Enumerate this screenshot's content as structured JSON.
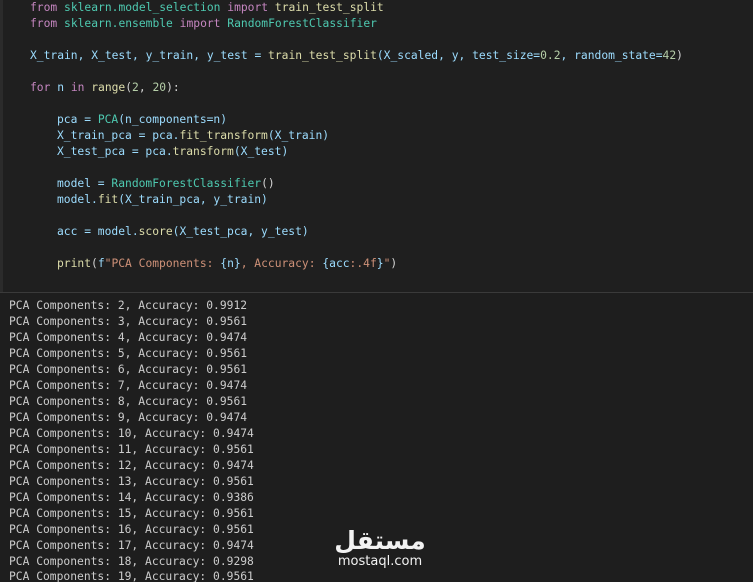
{
  "code": {
    "import1": {
      "kw1": "from",
      "mod": "sklearn.model_selection",
      "kw2": "import",
      "name": "train_test_split"
    },
    "import2": {
      "kw1": "from",
      "mod": "sklearn.ensemble",
      "kw2": "import",
      "name": "RandomForestClassifier"
    },
    "split": {
      "lhs": "X_train, X_test, y_train, y_test = ",
      "fn": "train_test_split",
      "args1": "(X_scaled, y, test_size=",
      "num1": "0.2",
      "args2": ", random_state=",
      "num2": "42",
      "close": ")"
    },
    "loop": {
      "kw1": "for",
      "var": " n ",
      "kw2": "in",
      "fn": " range",
      "open": "(",
      "num1": "2",
      "sep": ", ",
      "num2": "20",
      "close": "):"
    },
    "pca": {
      "lhs": "pca = ",
      "cls": "PCA",
      "args": "(n_components=n)"
    },
    "xtrain_pca": {
      "lhs": "X_train_pca = pca.",
      "fn": "fit_transform",
      "args": "(X_train)"
    },
    "xtest_pca": {
      "lhs": "X_test_pca = pca.",
      "fn": "transform",
      "args": "(X_test)"
    },
    "model": {
      "lhs": "model = ",
      "cls": "RandomForestClassifier",
      "args": "()"
    },
    "fit": {
      "lhs": "model.",
      "fn": "fit",
      "args": "(X_train_pca, y_train)"
    },
    "score": {
      "lhs": "acc = model.",
      "fn": "score",
      "args": "(X_test_pca, y_test)"
    },
    "print": {
      "fn": "print",
      "open": "(",
      "fprefix": "f",
      "s1": "\"PCA Components: ",
      "b1o": "{",
      "v1": "n",
      "b1c": "}",
      "s2": ", Accuracy: ",
      "b2o": "{",
      "v2": "acc",
      "fmt": ":.4f",
      "b2c": "}",
      "s3": "\"",
      "close": ")"
    }
  },
  "output": [
    "PCA Components: 2, Accuracy: 0.9912",
    "PCA Components: 3, Accuracy: 0.9561",
    "PCA Components: 4, Accuracy: 0.9474",
    "PCA Components: 5, Accuracy: 0.9561",
    "PCA Components: 6, Accuracy: 0.9561",
    "PCA Components: 7, Accuracy: 0.9474",
    "PCA Components: 8, Accuracy: 0.9561",
    "PCA Components: 9, Accuracy: 0.9474",
    "PCA Components: 10, Accuracy: 0.9474",
    "PCA Components: 11, Accuracy: 0.9561",
    "PCA Components: 12, Accuracy: 0.9474",
    "PCA Components: 13, Accuracy: 0.9561",
    "PCA Components: 14, Accuracy: 0.9386",
    "PCA Components: 15, Accuracy: 0.9561",
    "PCA Components: 16, Accuracy: 0.9561",
    "PCA Components: 17, Accuracy: 0.9474",
    "PCA Components: 18, Accuracy: 0.9298",
    "PCA Components: 19, Accuracy: 0.9561"
  ],
  "watermark": {
    "arabic": "مستقل",
    "latin": "mostaql.com"
  },
  "colors": {
    "background": "#1e1e1e",
    "keyword": "#c586c0",
    "function": "#dcdcaa",
    "class": "#4ec9b0",
    "variable": "#9cdcfe",
    "number": "#b5cea8",
    "string": "#ce9178"
  }
}
